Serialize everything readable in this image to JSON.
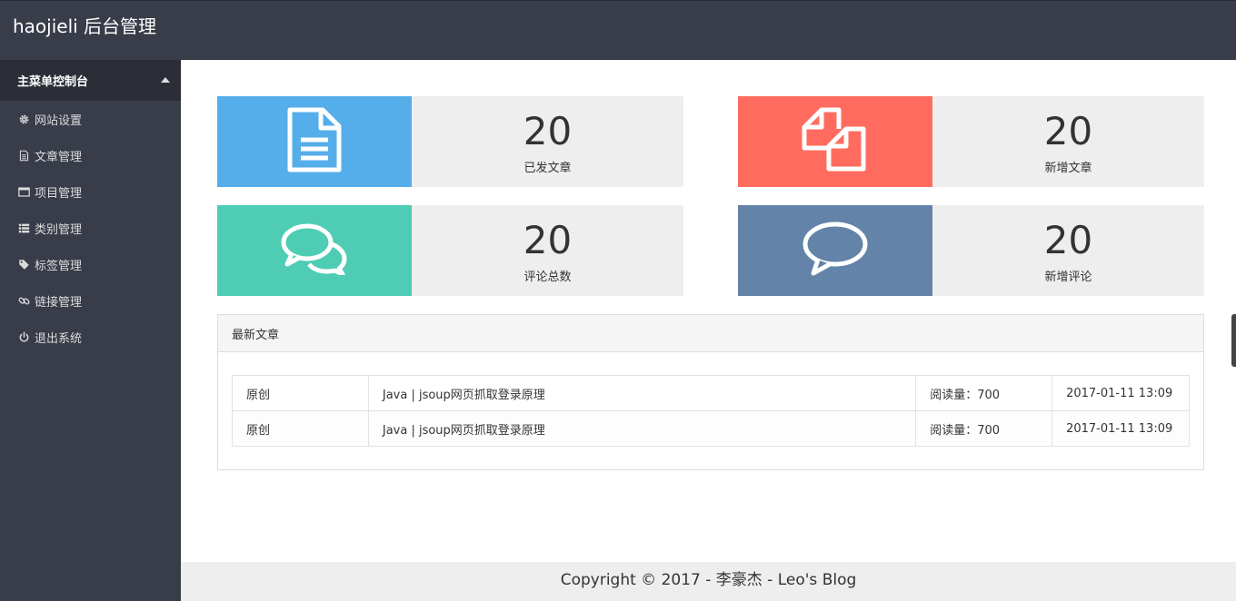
{
  "header": {
    "brand": "haojieli 后台管理"
  },
  "sidebar": {
    "head": "主菜单控制台",
    "items": [
      {
        "label": "网站设置",
        "icon": "gear-icon"
      },
      {
        "label": "文章管理",
        "icon": "file-icon"
      },
      {
        "label": "项目管理",
        "icon": "window-icon"
      },
      {
        "label": "类别管理",
        "icon": "list-icon"
      },
      {
        "label": "标签管理",
        "icon": "tag-icon"
      },
      {
        "label": "链接管理",
        "icon": "link-icon"
      },
      {
        "label": "退出系统",
        "icon": "power-icon"
      }
    ]
  },
  "stats": [
    {
      "value": "20",
      "label": "已发文章",
      "color": "#55aeea",
      "icon": "document-icon"
    },
    {
      "value": "20",
      "label": "新增文章",
      "color": "#ff6c5f",
      "icon": "copy-files-icon"
    },
    {
      "value": "20",
      "label": "评论总数",
      "color": "#4ecdb4",
      "icon": "comments-icon"
    },
    {
      "value": "20",
      "label": "新增评论",
      "color": "#6383a8",
      "icon": "comment-icon"
    }
  ],
  "latest": {
    "title": "最新文章",
    "rows": [
      {
        "type": "原创",
        "title": "Java | jsoup网页抓取登录原理",
        "views": "阅读量：700",
        "date": "2017-01-11 13:09"
      },
      {
        "type": "原创",
        "title": "Java | jsoup网页抓取登录原理",
        "views": "阅读量：700",
        "date": "2017-01-11 13:09"
      }
    ]
  },
  "footer": {
    "text": "Copyright © 2017 - 李豪杰 - Leo's Blog"
  }
}
